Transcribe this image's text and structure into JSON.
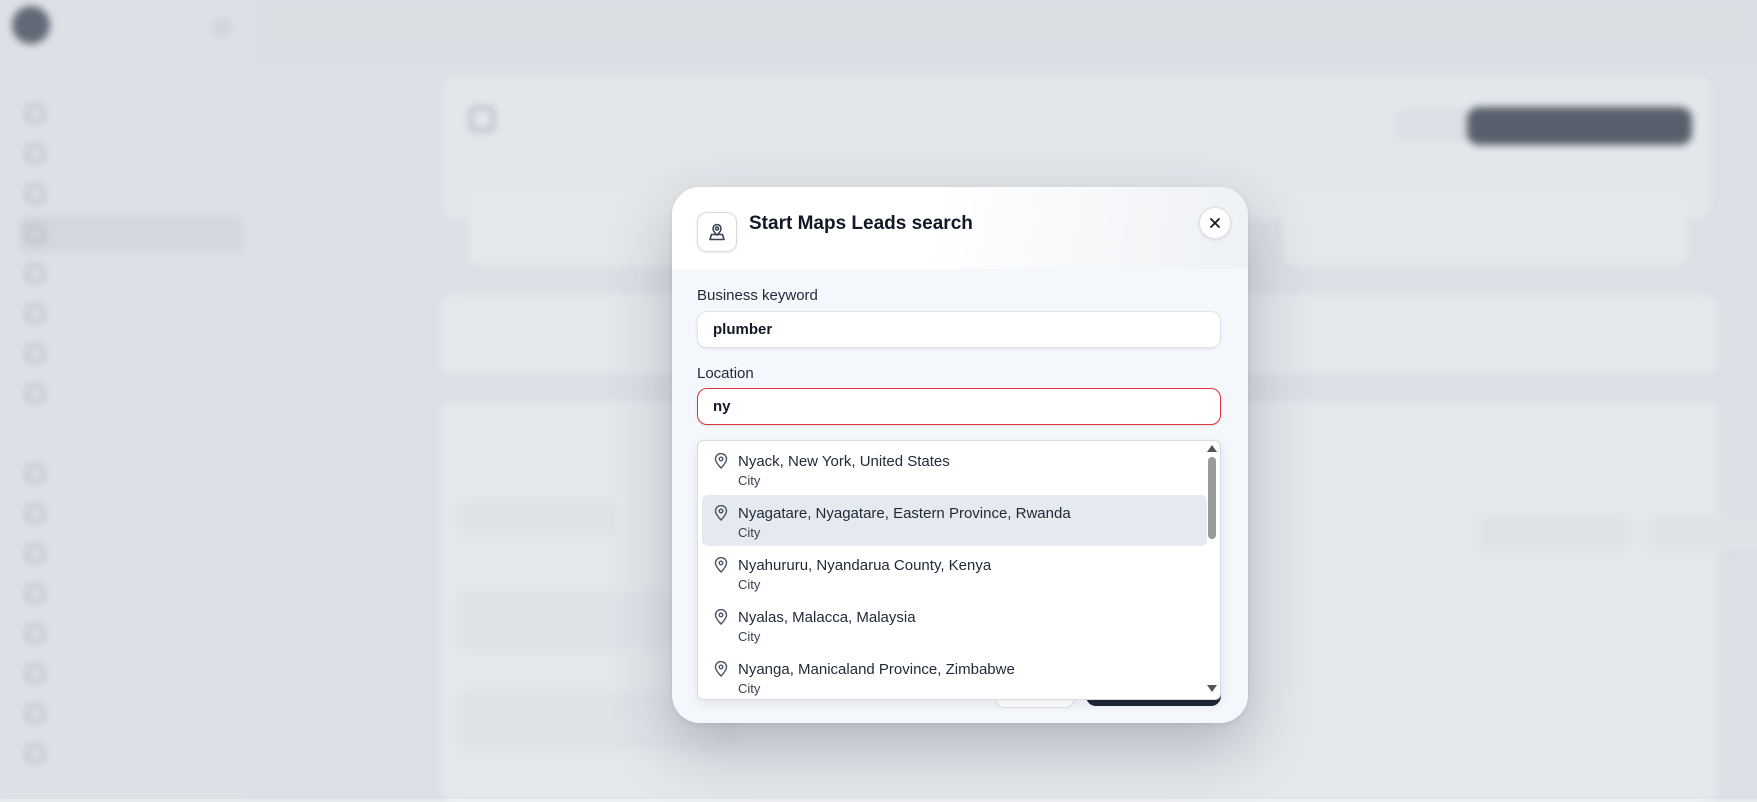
{
  "modal": {
    "title": "Start Maps Leads search",
    "close_icon": "close-icon",
    "head_icon": "map-pin-user-icon",
    "keyword_label": "Business keyword",
    "keyword_value": "plumber",
    "location_label": "Location",
    "location_value": "ny",
    "suggestions": [
      {
        "label": "Nyack, New York, United States",
        "type": "City"
      },
      {
        "label": "Nyagatare, Nyagatare, Eastern Province, Rwanda",
        "type": "City"
      },
      {
        "label": "Nyahururu, Nyandarua County, Kenya",
        "type": "City"
      },
      {
        "label": "Nyalas, Malacca, Malaysia",
        "type": "City"
      },
      {
        "label": "Nyanga, Manicaland Province, Zimbabwe",
        "type": "City"
      }
    ],
    "highlighted_index": 1,
    "error_color": "#e0343b"
  }
}
